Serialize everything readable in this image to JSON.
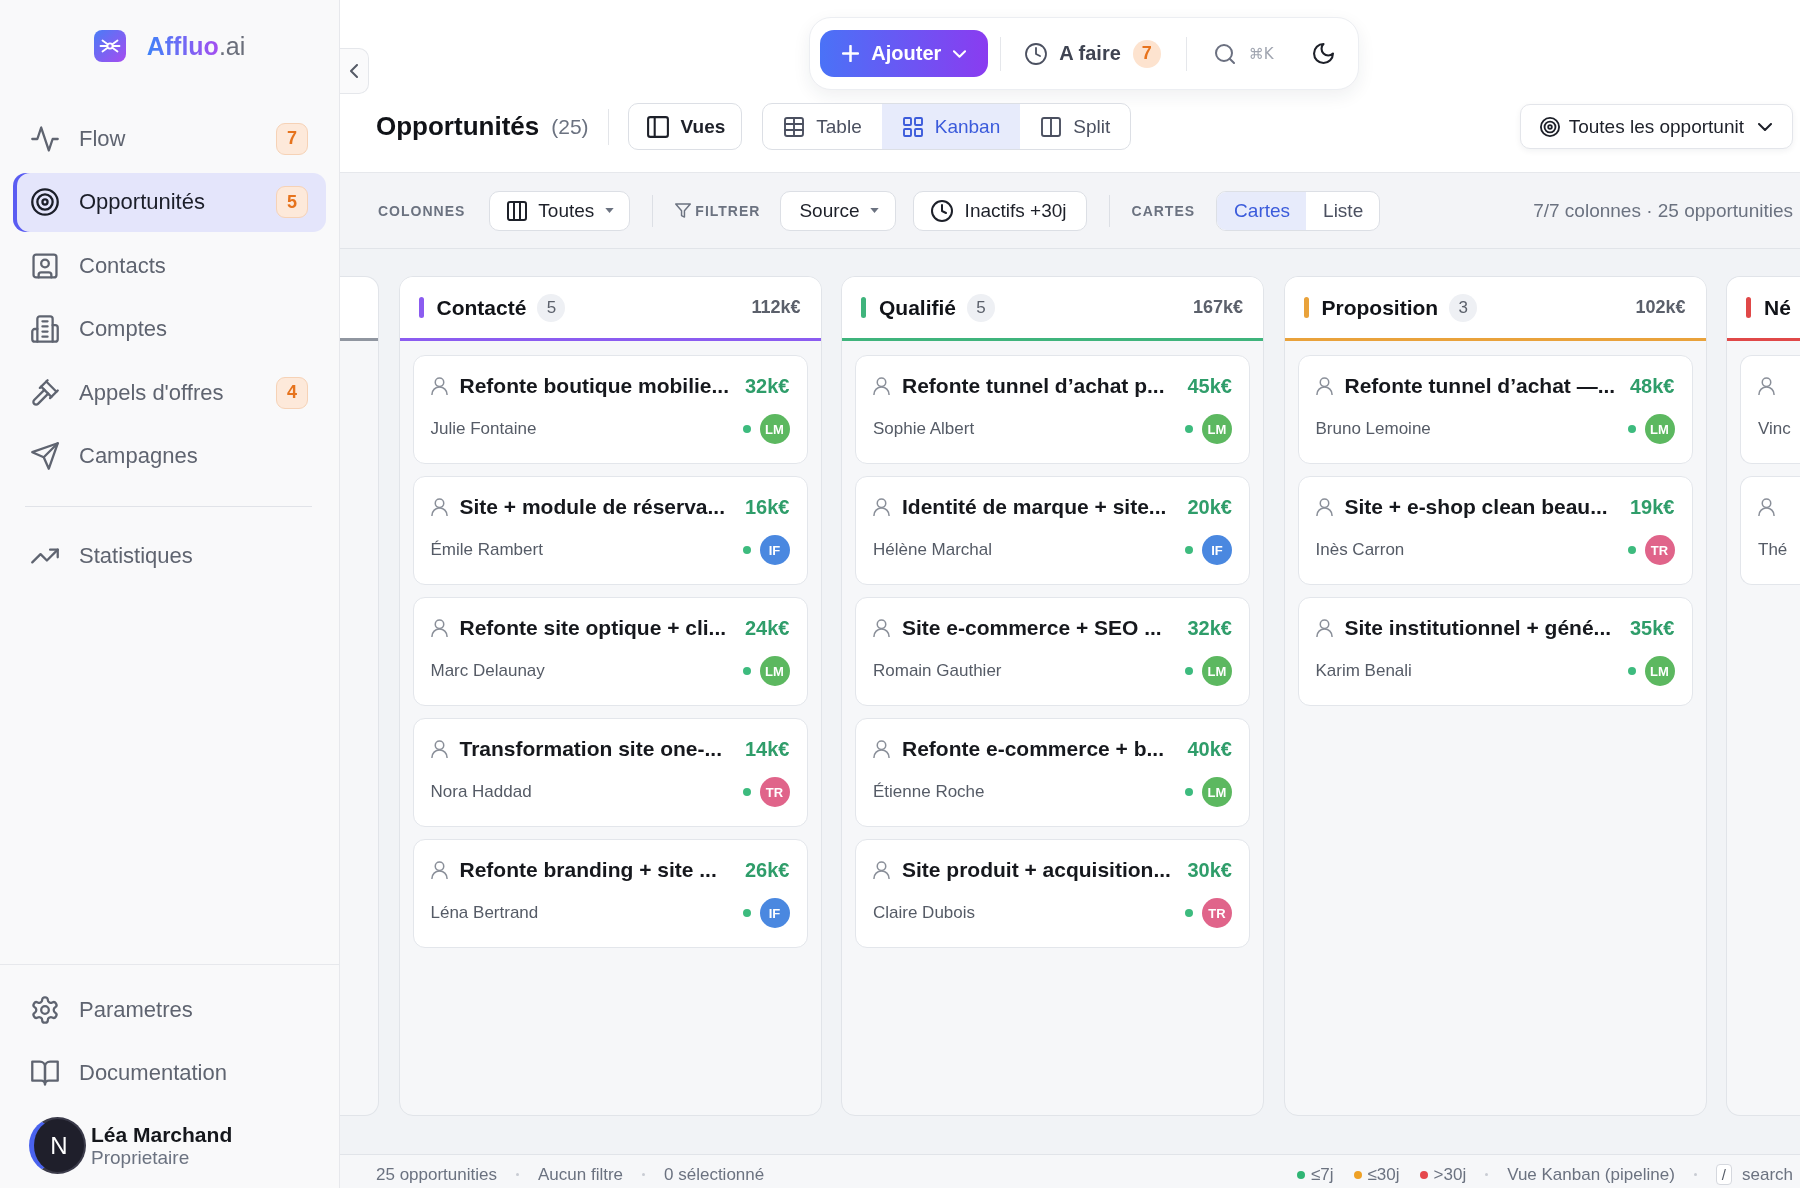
{
  "sidebar": {
    "logo_text": "**Affluo**.ai",
    "nav": [
      {
        "label": "Flow",
        "badge": "7",
        "selected": false
      },
      {
        "label": "Opportunités",
        "badge": "5",
        "selected": true
      },
      {
        "label": "Contacts",
        "selected": false
      },
      {
        "label": "Comptes",
        "selected": false
      },
      {
        "label": "Appels d'offres",
        "badge": "4",
        "selected": false
      },
      {
        "label": "Campagnes",
        "selected": false
      }
    ],
    "nav_secondary": [
      {
        "label": "Statistiques",
        "selected": false
      }
    ],
    "footer_nav": [
      {
        "label": "Parametres",
        "selected": false
      },
      {
        "label": "Documentation",
        "selected": false
      }
    ],
    "dev_badge": "N",
    "user": {
      "name": "Léa Marchand",
      "role": "Proprietaire"
    }
  },
  "quick_bar": {
    "add_button": "Ajouter",
    "todo": {
      "label": "A faire",
      "count": "7"
    },
    "search_shortcut": "⌘K"
  },
  "page_header": {
    "title": "Opportunités",
    "count": "(25)",
    "views_button": "Vues",
    "view_tabs": [
      {
        "label": "Table",
        "selected": false
      },
      {
        "label": "Kanban",
        "selected": true
      },
      {
        "label": "Split",
        "selected": false
      }
    ],
    "filter_dropdown": "Toutes les opportunit"
  },
  "toolbar": {
    "columns_label": "COLONNES",
    "columns_dropdown": "Toutes",
    "filter_label": "FILTRER",
    "source_dropdown": "Source",
    "inactive_button": "Inactifs +30j",
    "cards_label": "CARTES",
    "card_modes": [
      {
        "label": "Cartes",
        "selected": true
      },
      {
        "label": "Liste",
        "selected": false
      }
    ],
    "summary": "7/7 colonnes · 25 opportunities"
  },
  "board": {
    "columns": [
      {
        "title": "Contacté",
        "count": "5",
        "total": "112k€",
        "color": "#8b5cf0",
        "cards": [
          {
            "title": "Refonte boutique mobilie...",
            "amount": "32k€",
            "contact": "Julie Fontaine",
            "status_dot": {
              "color": "#3dbb7e"
            },
            "owner": {
              "initials": "LM",
              "color": "#5cb860"
            }
          },
          {
            "title": "Site + module de réserva...",
            "amount": "16k€",
            "contact": "Émile Rambert",
            "status_dot": {
              "color": "#3dbb7e"
            },
            "owner": {
              "initials": "IF",
              "color": "#4a88e0"
            }
          },
          {
            "title": "Refonte site optique + cli...",
            "amount": "24k€",
            "contact": "Marc Delaunay",
            "status_dot": {
              "color": "#3dbb7e"
            },
            "owner": {
              "initials": "LM",
              "color": "#5cb860"
            }
          },
          {
            "title": "Transformation site one-...",
            "amount": "14k€",
            "contact": "Nora Haddad",
            "status_dot": {
              "color": "#3dbb7e"
            },
            "owner": {
              "initials": "TR",
              "color": "#e0648a"
            }
          },
          {
            "title": "Refonte branding + site ...",
            "amount": "26k€",
            "contact": "Léna Bertrand",
            "status_dot": {
              "color": "#3dbb7e"
            },
            "owner": {
              "initials": "IF",
              "color": "#4a88e0"
            }
          }
        ]
      },
      {
        "title": "Qualifié",
        "count": "5",
        "total": "167k€",
        "color": "#3fb47c",
        "cards": [
          {
            "title": "Refonte tunnel d’achat p...",
            "amount": "45k€",
            "contact": "Sophie Albert",
            "status_dot": {
              "color": "#3dbb7e"
            },
            "owner": {
              "initials": "LM",
              "color": "#5cb860"
            }
          },
          {
            "title": "Identité de marque + site...",
            "amount": "20k€",
            "contact": "Hélène Marchal",
            "status_dot": {
              "color": "#3dbb7e"
            },
            "owner": {
              "initials": "IF",
              "color": "#4a88e0"
            }
          },
          {
            "title": "Site e-commerce + SEO ...",
            "amount": "32k€",
            "contact": "Romain Gauthier",
            "status_dot": {
              "color": "#3dbb7e"
            },
            "owner": {
              "initials": "LM",
              "color": "#5cb860"
            }
          },
          {
            "title": "Refonte e-commerce + b...",
            "amount": "40k€",
            "contact": "Étienne Roche",
            "status_dot": {
              "color": "#3dbb7e"
            },
            "owner": {
              "initials": "LM",
              "color": "#5cb860"
            }
          },
          {
            "title": "Site produit + acquisition...",
            "amount": "30k€",
            "contact": "Claire Dubois",
            "status_dot": {
              "color": "#3dbb7e"
            },
            "owner": {
              "initials": "TR",
              "color": "#e0648a"
            }
          }
        ]
      },
      {
        "title": "Proposition",
        "count": "3",
        "total": "102k€",
        "color": "#e9a23b",
        "cards": [
          {
            "title": "Refonte tunnel d’achat —...",
            "amount": "48k€",
            "contact": "Bruno Lemoine",
            "status_dot": {
              "color": "#3dbb7e"
            },
            "owner": {
              "initials": "LM",
              "color": "#5cb860"
            }
          },
          {
            "title": "Site + e-shop clean beau...",
            "amount": "19k€",
            "contact": "Inès Carron",
            "status_dot": {
              "color": "#3dbb7e"
            },
            "owner": {
              "initials": "TR",
              "color": "#e0648a"
            }
          },
          {
            "title": "Site institutionnel + géné...",
            "amount": "35k€",
            "contact": "Karim Benali",
            "status_dot": {
              "color": "#3dbb7e"
            },
            "owner": {
              "initials": "LM",
              "color": "#5cb860"
            }
          }
        ]
      },
      {
        "title": "Né",
        "color": "#e04848",
        "cards": [
          {
            "contact": "Vinc"
          },
          {
            "contact": "Thé"
          }
        ]
      }
    ]
  },
  "status_bar": {
    "left": [
      "25 opportunities",
      "Aucun filtre",
      "0 sélectionné"
    ],
    "legend": [
      {
        "label": "≤7j",
        "color": "#2fb574"
      },
      {
        "label": "≤30j",
        "color": "#eea126"
      },
      {
        "label": ">30j",
        "color": "#e5484d"
      }
    ],
    "view": "Vue Kanban (pipeline)",
    "shortcut": {
      "key": "/",
      "label": "search"
    }
  }
}
